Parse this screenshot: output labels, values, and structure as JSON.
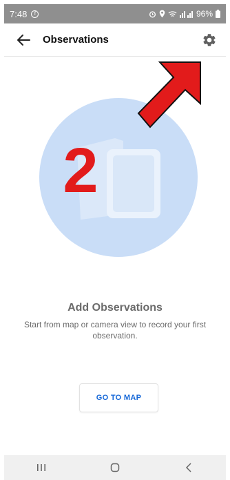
{
  "status_bar": {
    "time": "7:48",
    "battery": "96%",
    "icons": [
      "facebook-icon",
      "alarm-icon",
      "location-icon",
      "wifi-icon",
      "signal-icon",
      "battery-icon"
    ]
  },
  "header": {
    "title": "Observations",
    "back_icon": "back-arrow-icon",
    "settings_icon": "gear-icon"
  },
  "illustration": {
    "overlay_number": "2",
    "circle_color": "#c9ddf7",
    "annotation_color": "#e21b1b"
  },
  "empty_state": {
    "title": "Add Observations",
    "description": "Start from map or camera view to record your first observation."
  },
  "button": {
    "label": "GO TO MAP",
    "color": "#1668d8"
  },
  "nav_bar": {
    "icons": [
      "recent-apps-icon",
      "home-icon",
      "back-icon"
    ]
  }
}
